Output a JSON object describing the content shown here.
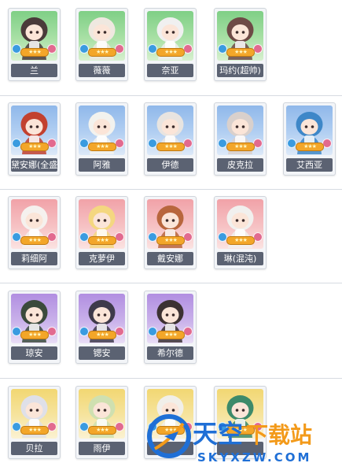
{
  "rows": [
    {
      "color": "green",
      "items": [
        {
          "name": "兰"
        },
        {
          "name": "薇薇"
        },
        {
          "name": "奈亚"
        },
        {
          "name": "玛约(超帅)"
        }
      ]
    },
    {
      "color": "blue",
      "items": [
        {
          "name": "黛安娜(全盛)"
        },
        {
          "name": "阿雅"
        },
        {
          "name": "伊德"
        },
        {
          "name": "皮克拉"
        },
        {
          "name": "艾西亚"
        }
      ]
    },
    {
      "color": "red",
      "items": [
        {
          "name": "莉细阿"
        },
        {
          "name": "克萝伊"
        },
        {
          "name": "戴安娜"
        },
        {
          "name": "琳(混沌)"
        }
      ]
    },
    {
      "color": "purple",
      "items": [
        {
          "name": "琼安"
        },
        {
          "name": "锶安"
        },
        {
          "name": "希尔德"
        }
      ]
    },
    {
      "color": "yellow",
      "items": [
        {
          "name": "贝拉"
        },
        {
          "name": "雨伊"
        },
        {
          "name": ""
        },
        {
          "name": ""
        }
      ]
    }
  ],
  "watermark": {
    "brand": "天空下载站",
    "url": "SKYXZW.COM",
    "brand_colors": {
      "blue": "#1f6fd6",
      "orange": "#f39a1a"
    }
  }
}
